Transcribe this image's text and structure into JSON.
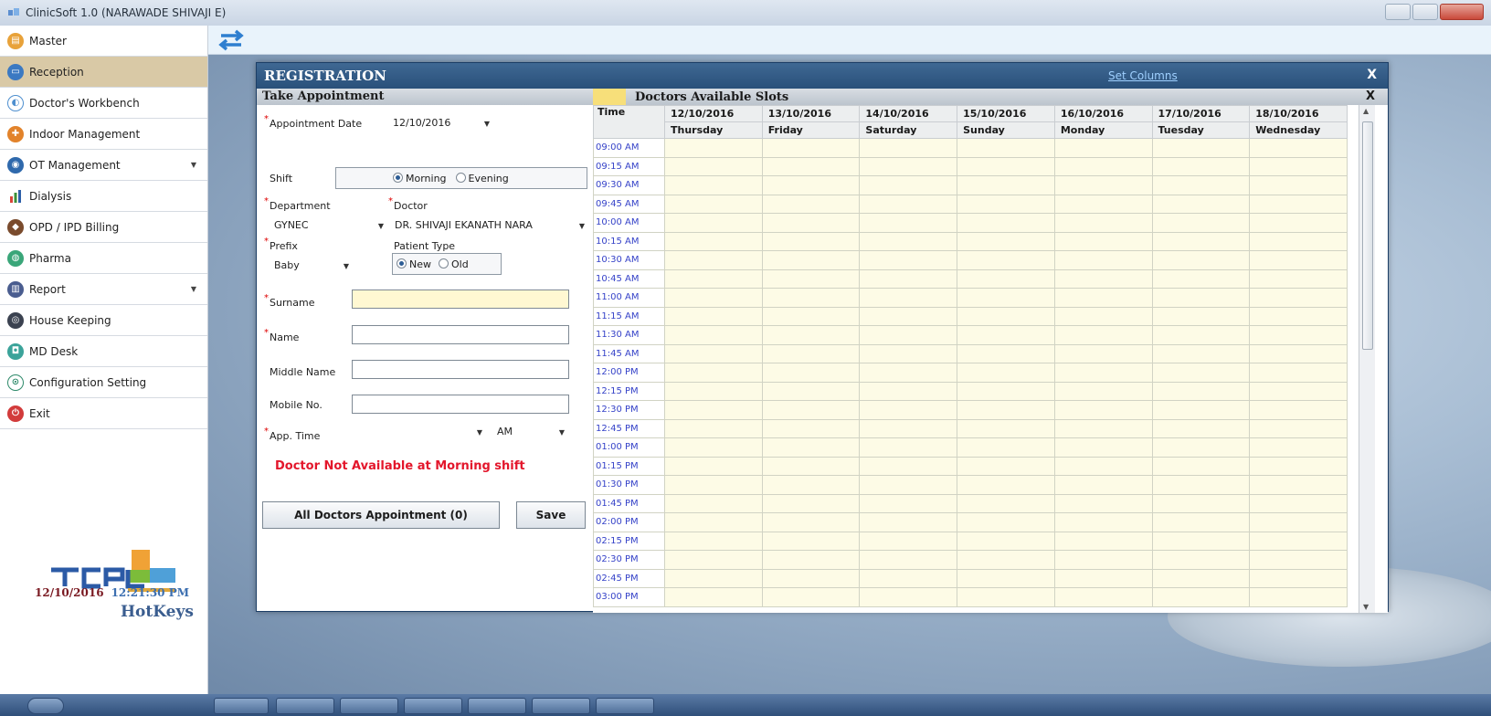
{
  "window": {
    "title": "ClinicSoft 1.0  (NARAWADE SHIVAJI E)"
  },
  "sidebar": {
    "items": [
      {
        "label": "Master",
        "color": "#e8a23a",
        "glyph": "▤"
      },
      {
        "label": "Reception",
        "color": "#3b79c2",
        "glyph": "▭"
      },
      {
        "label": "Doctor's Workbench",
        "color": "#4e8fcf",
        "glyph": "◐"
      },
      {
        "label": "Indoor Management",
        "color": "#e2832b",
        "glyph": "✚"
      },
      {
        "label": "OT Management",
        "color": "#2f69ac",
        "glyph": "◉"
      },
      {
        "label": "Dialysis",
        "color": "#ffffff",
        "glyph": "▮"
      },
      {
        "label": "OPD / IPD Billing",
        "color": "#7a4b2d",
        "glyph": "◆"
      },
      {
        "label": "Pharma",
        "color": "#3aa679",
        "glyph": "◍"
      },
      {
        "label": "Report",
        "color": "#4a5d8f",
        "glyph": "▥"
      },
      {
        "label": "House Keeping",
        "color": "#3b4250",
        "glyph": "◎"
      },
      {
        "label": "MD Desk",
        "color": "#3ba39a",
        "glyph": "◘"
      },
      {
        "label": "Configuration Setting",
        "color": "#ffffff",
        "glyph": "⊙"
      },
      {
        "label": "Exit",
        "color": "#d23b3b",
        "glyph": "⏻"
      }
    ],
    "date": "12/10/2016",
    "time": "12:21:30 PM",
    "hotkeys": "HotKeys"
  },
  "registration": {
    "title": "REGISTRATION",
    "set_columns": "Set Columns",
    "close": "X"
  },
  "appointment": {
    "heading": "Take Appointment",
    "appointment_date_label": "Appointment Date",
    "appointment_date_value": "12/10/2016",
    "shift_label": "Shift",
    "shift_morning": "Morning",
    "shift_evening": "Evening",
    "department_label": "Department",
    "department_value": "GYNEC",
    "doctor_label": "Doctor",
    "doctor_value": "DR. SHIVAJI EKANATH NARA",
    "prefix_label": "Prefix",
    "prefix_value": "Baby",
    "patient_type_label": "Patient Type",
    "patient_type_new": "New",
    "patient_type_old": "Old",
    "surname_label": "Surname",
    "name_label": "Name",
    "middle_name_label": "Middle Name",
    "mobile_label": "Mobile No.",
    "app_time_label": "App. Time",
    "app_time_ampm": "AM",
    "warning": "Doctor Not Available at Morning shift",
    "all_doctors_button": "All Doctors Appointment (0)",
    "save_button": "Save"
  },
  "slots": {
    "heading": "Doctors Available Slots",
    "close": "X",
    "time_header": "Time",
    "days": [
      {
        "date": "12/10/2016",
        "day": "Thursday"
      },
      {
        "date": "13/10/2016",
        "day": "Friday"
      },
      {
        "date": "14/10/2016",
        "day": "Saturday"
      },
      {
        "date": "15/10/2016",
        "day": "Sunday"
      },
      {
        "date": "16/10/2016",
        "day": "Monday"
      },
      {
        "date": "17/10/2016",
        "day": "Tuesday"
      },
      {
        "date": "18/10/2016",
        "day": "Wednesday"
      }
    ],
    "times": [
      "09:00 AM",
      "09:15 AM",
      "09:30 AM",
      "09:45 AM",
      "10:00 AM",
      "10:15 AM",
      "10:30 AM",
      "10:45 AM",
      "11:00 AM",
      "11:15 AM",
      "11:30 AM",
      "11:45 AM",
      "12:00 PM",
      "12:15 PM",
      "12:30 PM",
      "12:45 PM",
      "01:00 PM",
      "01:15 PM",
      "01:30 PM",
      "01:45 PM",
      "02:00 PM",
      "02:15 PM",
      "02:30 PM",
      "02:45 PM",
      "03:00 PM"
    ]
  }
}
